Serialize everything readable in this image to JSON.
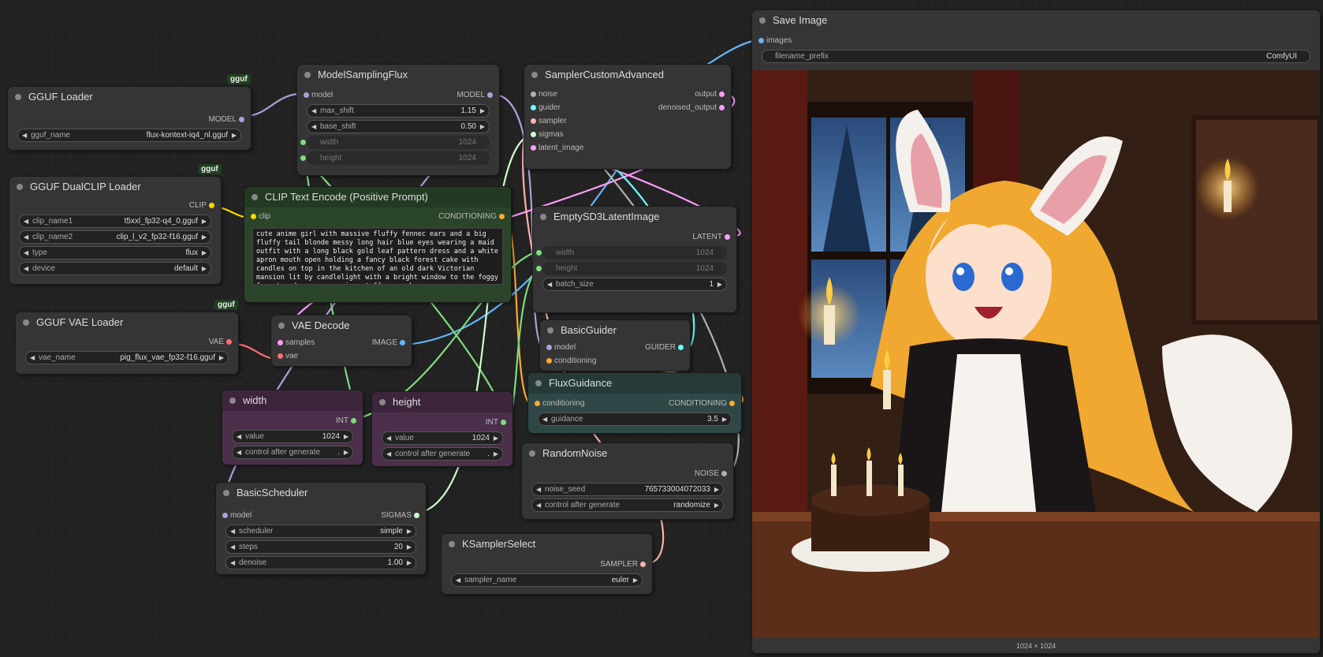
{
  "colors": {
    "model": "#b39ddb",
    "clip": "#ffd500",
    "conditioning": "#ffa931",
    "vae": "#ff6e6e",
    "image": "#64b5f6",
    "latent": "#ff9cf9",
    "int": "#7ddc7d",
    "sigmas": "#cdffcd",
    "sampler": "#ffb0b0",
    "guider": "#66ffff",
    "noise": "#b0b0b0"
  },
  "tags": {
    "gguf1": "gguf",
    "gguf2": "gguf",
    "gguf3": "gguf"
  },
  "gguf_loader": {
    "title": "GGUF Loader",
    "out": "MODEL",
    "w_label": "gguf_name",
    "w_value": "flux-kontext-iq4_nl.gguf"
  },
  "dualclip": {
    "title": "GGUF DualCLIP Loader",
    "out": "CLIP",
    "widgets": [
      {
        "label": "clip_name1",
        "value": "t5xxl_fp32-q4_0.gguf"
      },
      {
        "label": "clip_name2",
        "value": "clip_l_v2_fp32-f16.gguf"
      },
      {
        "label": "type",
        "value": "flux"
      },
      {
        "label": "device",
        "value": "default"
      }
    ]
  },
  "vae_loader": {
    "title": "GGUF VAE Loader",
    "out": "VAE",
    "w_label": "vae_name",
    "w_value": "pig_flux_vae_fp32-f16.gguf"
  },
  "msf": {
    "title": "ModelSamplingFlux",
    "in": "model",
    "out": "MODEL",
    "widgets": [
      {
        "label": "max_shift",
        "value": "1.15"
      },
      {
        "label": "base_shift",
        "value": "0.50"
      },
      {
        "label": "width",
        "value": "1024"
      },
      {
        "label": "height",
        "value": "1024"
      }
    ]
  },
  "clip_encode": {
    "title": "CLIP Text Encode (Positive Prompt)",
    "in": "clip",
    "out": "CONDITIONING",
    "prompt": "cute anime girl with massive fluffy fennec ears and a big fluffy tail blonde messy long hair blue eyes wearing a maid outfit with a long black gold leaf pattern dress and a white apron mouth open holding a fancy black forest cake with candles on top in the kitchen of an old dark Victorian mansion lit by candlelight with a bright window to the foggy forest and very expensive stuff everywhere"
  },
  "vae_decode": {
    "title": "VAE Decode",
    "in1": "samples",
    "in2": "vae",
    "out": "IMAGE"
  },
  "width_node": {
    "title": "width",
    "out": "INT",
    "w1_label": "value",
    "w1_value": "1024",
    "w2_label": "control after generate",
    "w2_value": "."
  },
  "height_node": {
    "title": "height",
    "out": "INT",
    "w1_label": "value",
    "w1_value": "1024",
    "w2_label": "control after generate",
    "w2_value": "."
  },
  "scheduler": {
    "title": "BasicScheduler",
    "in": "model",
    "out": "SIGMAS",
    "widgets": [
      {
        "label": "scheduler",
        "value": "simple"
      },
      {
        "label": "steps",
        "value": "20"
      },
      {
        "label": "denoise",
        "value": "1.00"
      }
    ]
  },
  "sca": {
    "title": "SamplerCustomAdvanced",
    "inputs": [
      "noise",
      "guider",
      "sampler",
      "sigmas",
      "latent_image"
    ],
    "outputs": [
      "output",
      "denoised_output"
    ]
  },
  "latent": {
    "title": "EmptySD3LatentImage",
    "out": "LATENT",
    "widgets": [
      {
        "label": "width",
        "value": "1024"
      },
      {
        "label": "height",
        "value": "1024"
      },
      {
        "label": "batch_size",
        "value": "1"
      }
    ]
  },
  "guider": {
    "title": "BasicGuider",
    "in1": "model",
    "in2": "conditioning",
    "out": "GUIDER"
  },
  "flux_guidance": {
    "title": "FluxGuidance",
    "in": "conditioning",
    "out": "CONDITIONING",
    "w_label": "guidance",
    "w_value": "3.5"
  },
  "random_noise": {
    "title": "RandomNoise",
    "out": "NOISE",
    "w1_label": "noise_seed",
    "w1_value": "765733004072033",
    "w2_label": "control after generate",
    "w2_value": "randomize"
  },
  "ksampler_select": {
    "title": "KSamplerSelect",
    "out": "SAMPLER",
    "w_label": "sampler_name",
    "w_value": "euler"
  },
  "save_image": {
    "title": "Save Image",
    "in": "images",
    "w_label": "filename_prefix",
    "w_value": "ComfyUI",
    "dims": "1024 × 1024"
  }
}
